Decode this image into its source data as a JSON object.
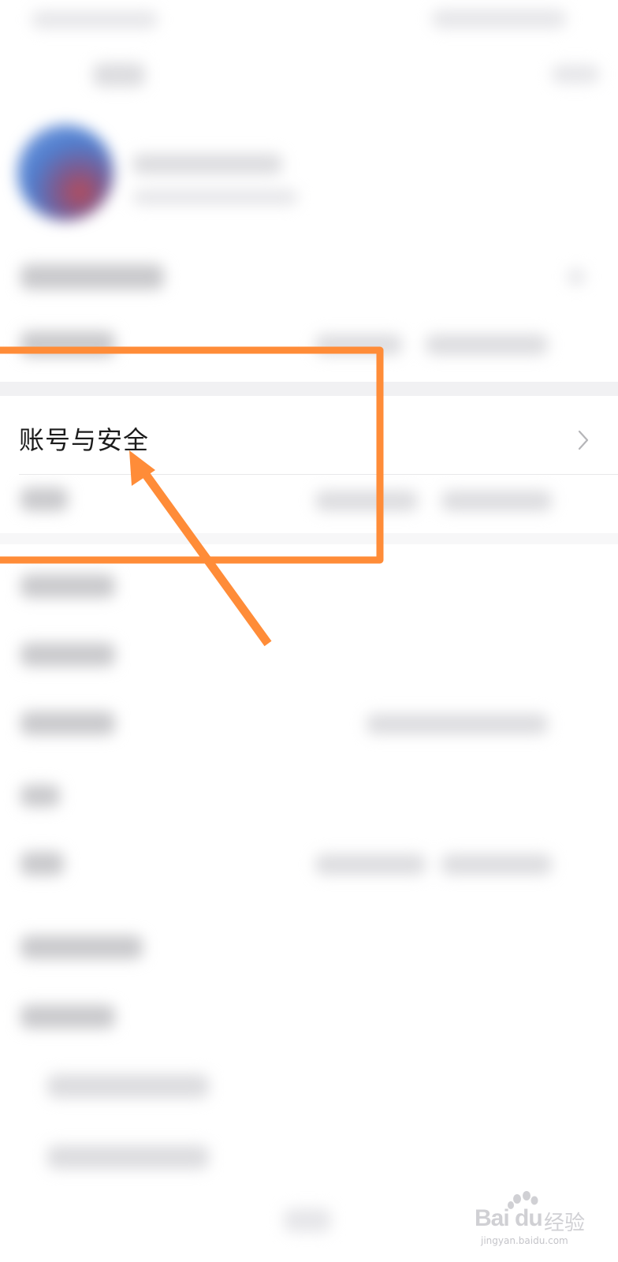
{
  "settings": {
    "highlighted_item": {
      "label": "账号与安全",
      "icon": "chevron-right-icon"
    }
  },
  "watermark": {
    "brand": "Bai du",
    "cn": "经验",
    "url": "jingyan.baidu.com"
  },
  "colors": {
    "annotation": "#FF8C38",
    "background": "#ffffff",
    "section_gap": "#f1f1f3",
    "label_text": "#1c1c1c"
  }
}
